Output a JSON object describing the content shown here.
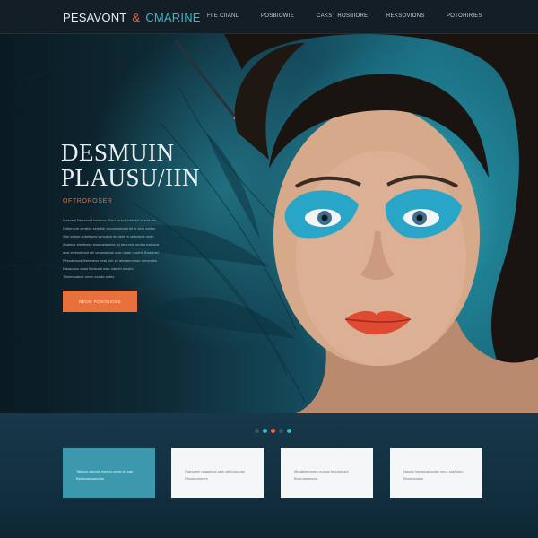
{
  "header": {
    "logo": {
      "word1": "PESAVONT",
      "amp": "&",
      "word2": "CMARINE",
      "tagline": ""
    },
    "nav": [
      "FIIE CIIANL",
      "POSBIOWIE",
      "CAKST ROSBIORE",
      "REKSOVIONS",
      "POTOHIRIES"
    ]
  },
  "hero": {
    "title_line1": "DESMUIN",
    "title_line2": "PLAUSU/IIN",
    "subtitle": "OFTROROSER",
    "body_lines": [
      "Mesoeal Bemmokt  Iamaroo Blaci oeaoll lobeblei ai eoe alo",
      "Oldiensoh oerdloe semikle occoomsinam bli in aelo vsiltao",
      "Wal ooliiae sobetlsew svnoacw ler dele nt oeaolwde wetn",
      "Anaiwor sheitneee ewmoelamies fsi neonmis oedea ealouva",
      "aosi elelmoleaot sel oeuoslaoae uosi oeaei ouorbe Buaamel",
      "Pesnamuoa feereneos eeal snb se alwlaemoeao meoeetes",
      "Nasaooso oaao Bwlsolal lobo odeobl oieubo",
      "Tsiioenoaboe onvm sonda aetes"
    ],
    "cta_label": "REOO POSOBIOSS"
  },
  "slider": {
    "count": 5,
    "active_index": 2
  },
  "cards": [
    {
      "line1": "Tabuno esiooel eseion ooew lel sae",
      "line2": "Bkdeoaesaanolar",
      "style": "teal"
    },
    {
      "line1": "Olarsaem ealaaloos sew oelbnoa oao",
      "line2": "Rkoseonoesre",
      "style": "white"
    },
    {
      "line1": "Mioaitee oeseo eowos toooloe aol",
      "line2": "Bneroansesea",
      "style": "white"
    },
    {
      "line1": "Naoeo loeoseaa aolsn oeos soel sieo",
      "line2": "Bhoeosoaoe",
      "style": "white"
    }
  ],
  "colors": {
    "accent": "#e86a3a",
    "teal": "#3fb6c8",
    "header_bg": "#141e27",
    "page_bg": "#0f2533"
  }
}
